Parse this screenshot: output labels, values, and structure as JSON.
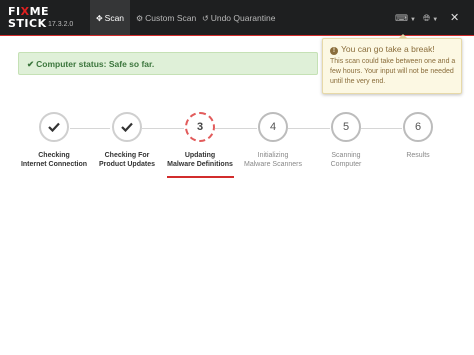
{
  "app": {
    "logo_line1_a": "FI",
    "logo_line1_mark": "X",
    "logo_line1_b": "ME",
    "logo_line2": "STICK",
    "version": "17.3.2.0"
  },
  "nav": {
    "tabs": [
      {
        "label": "Scan",
        "icon": "crosshair-icon",
        "active": true
      },
      {
        "label": "Custom Scan",
        "icon": "gear-icon",
        "active": false
      },
      {
        "label": "Undo Quarantine",
        "icon": "undo-icon",
        "active": false
      }
    ],
    "right_icons": [
      "keyboard-icon",
      "globe-icon",
      "close-icon"
    ],
    "close_glyph": "✕"
  },
  "status": {
    "text": "Computer status: Safe so far.",
    "color": "#3c763d"
  },
  "tooltip": {
    "title": "You can go take a break!",
    "body": "This scan could take between one and a few hours. Your input will not be needed until the very end.",
    "icon": "info-icon"
  },
  "steps": [
    {
      "label_line1": "Checking",
      "label_line2": "Internet Connection",
      "state": "done",
      "number": ""
    },
    {
      "label_line1": "Checking For",
      "label_line2": "Product Updates",
      "state": "done",
      "number": ""
    },
    {
      "label_line1": "Updating",
      "label_line2": "Malware Definitions",
      "state": "active",
      "number": "3"
    },
    {
      "label_line1": "Initializing",
      "label_line2": "Malware Scanners",
      "state": "pending",
      "number": "4"
    },
    {
      "label_line1": "Scanning",
      "label_line2": "Computer",
      "state": "pending",
      "number": "5"
    },
    {
      "label_line1": "Results",
      "label_line2": "",
      "state": "pending",
      "number": "6"
    }
  ],
  "colors": {
    "accent": "#d22c2c",
    "topbar": "#1e1f20",
    "status_bg": "#dff0d8",
    "tooltip_bg": "#fcf8e3"
  }
}
